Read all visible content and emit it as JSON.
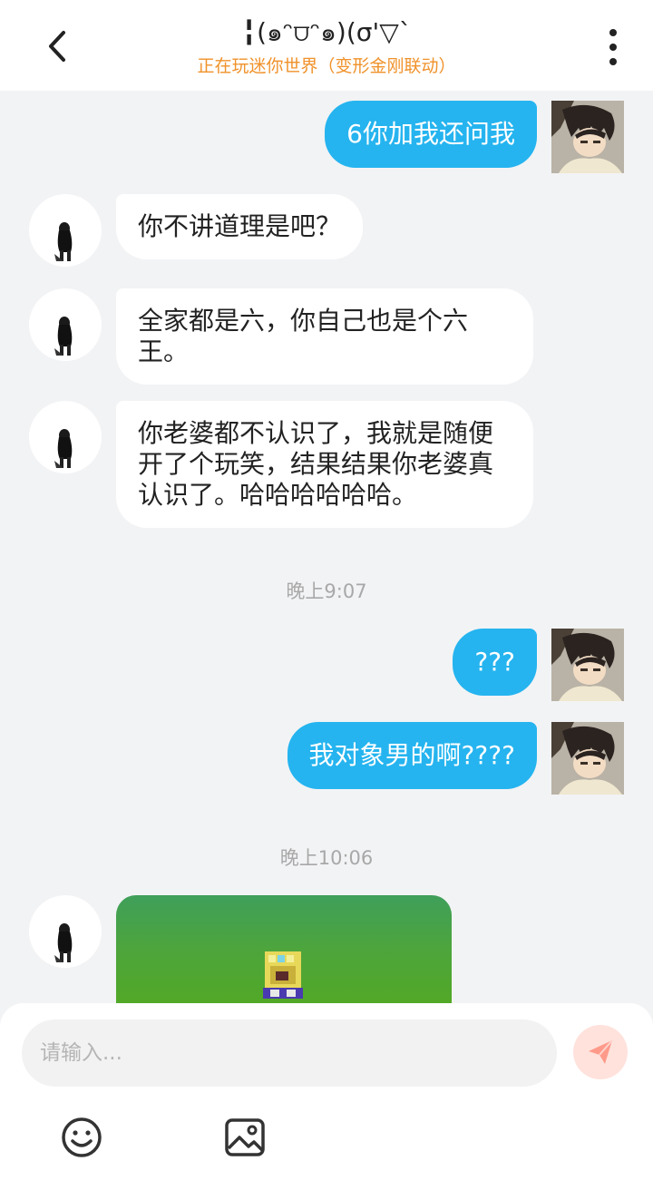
{
  "header": {
    "title": "╏(๑ᵔ⩌ᵔ๑)(σ'▽`",
    "status": "正在玩迷你世界（变形金刚联动）"
  },
  "messages": {
    "m1": "6你加我还问我",
    "m2": "你不讲道理是吧？",
    "m3": "全家都是六，你自己也是个六王。",
    "m4": "你老婆都不认识了，我就是随便开了个玩笑，结果结果你老婆真认识了。哈哈哈哈哈哈。",
    "time1": "晚上9:07",
    "m5": "???",
    "m6": "我对象男的啊????",
    "time2": "晚上10:06"
  },
  "input": {
    "placeholder": "请输入..."
  },
  "icons": {
    "back": "chevron-left-icon",
    "more": "more-vertical-icon",
    "send": "paper-plane-icon",
    "emoji": "smiley-icon",
    "image": "image-icon"
  },
  "colors": {
    "my_bubble": "#25b4ef",
    "status_text": "#f0922b",
    "send_button": "#ff8a7a"
  }
}
